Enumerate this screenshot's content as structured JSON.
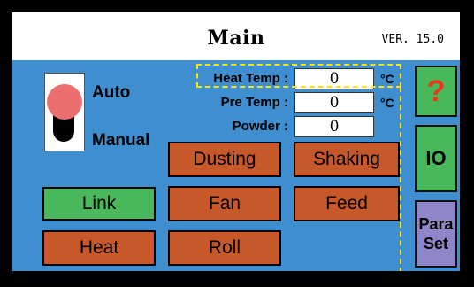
{
  "header": {
    "title": "Main",
    "version": "VER. 15.0"
  },
  "mode_switch": {
    "auto_label": "Auto",
    "manual_label": "Manual",
    "selected": "Auto"
  },
  "readings": {
    "heat_temp": {
      "label": "Heat Temp :",
      "value": "0",
      "unit": "°C"
    },
    "pre_temp": {
      "label": "Pre Temp :",
      "value": "0",
      "unit": "°C"
    },
    "powder": {
      "label": "Powder :",
      "value": "0"
    }
  },
  "buttons": {
    "dusting": "Dusting",
    "shaking": "Shaking",
    "link": "Link",
    "fan": "Fan",
    "feed": "Feed",
    "heat": "Heat",
    "roll": "Roll"
  },
  "side_buttons": {
    "help": "?",
    "io": "IO",
    "para_line1": "Para",
    "para_line2": "Set"
  },
  "colors": {
    "screen_bg": "#3f8fd0",
    "orange_button": "#c7582a",
    "green_button": "#48b85a",
    "side_button": "#8f86c9",
    "io_button": "#48b85a",
    "help_mark": "#e53b1b",
    "dash_highlight": "#ffe600",
    "switch_knob": "#ec6f6f"
  },
  "icons": {
    "help": "question-mark-icon",
    "mode_switch": "toggle-switch-icon"
  }
}
